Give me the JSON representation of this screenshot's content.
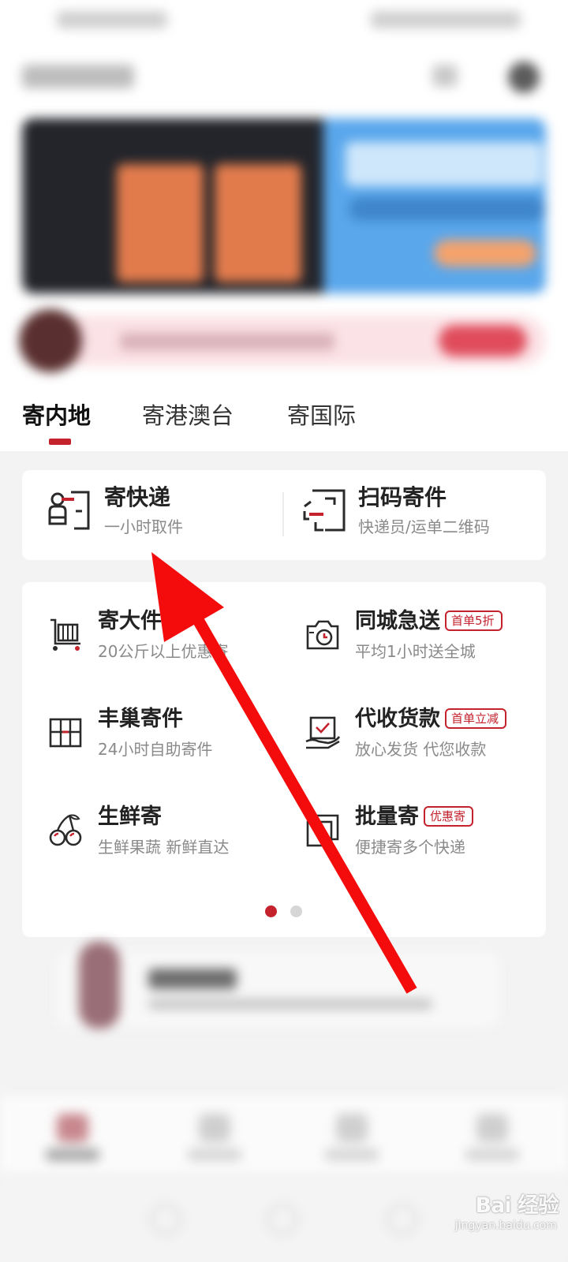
{
  "tabs": {
    "items": [
      {
        "label": "寄内地",
        "active": true
      },
      {
        "label": "寄港澳台",
        "active": false
      },
      {
        "label": "寄国际",
        "active": false
      }
    ]
  },
  "primary_services": [
    {
      "title": "寄快递",
      "subtitle": "一小时取件",
      "icon": "parcel-station-icon"
    },
    {
      "title": "扫码寄件",
      "subtitle": "快递员/运单二维码",
      "icon": "scan-code-icon"
    }
  ],
  "services": [
    {
      "title": "寄大件",
      "subtitle": "20公斤以上优惠寄",
      "badge": "",
      "icon": "cart-icon"
    },
    {
      "title": "同城急送",
      "subtitle": "平均1小时送全城",
      "badge": "首单5折",
      "icon": "clock-camera-icon"
    },
    {
      "title": "丰巢寄件",
      "subtitle": "24小时自助寄件",
      "badge": "",
      "icon": "locker-icon"
    },
    {
      "title": "代收货款",
      "subtitle": "放心发货 代您收款",
      "badge": "首单立减",
      "icon": "hand-check-icon"
    },
    {
      "title": "生鲜寄",
      "subtitle": "生鲜果蔬 新鲜直达",
      "badge": "",
      "icon": "cherry-icon"
    },
    {
      "title": "批量寄",
      "subtitle": "便捷寄多个快递",
      "badge": "优惠寄",
      "icon": "stacked-boxes-icon"
    }
  ],
  "pagination": {
    "pages": 2,
    "current": 1
  },
  "colors": {
    "accent": "#c4222d",
    "arrow": "#f40c0c",
    "background": "#f3f3f4"
  },
  "watermark": {
    "logo": "Bai 经验",
    "url": "jingyan.baidu.com"
  }
}
